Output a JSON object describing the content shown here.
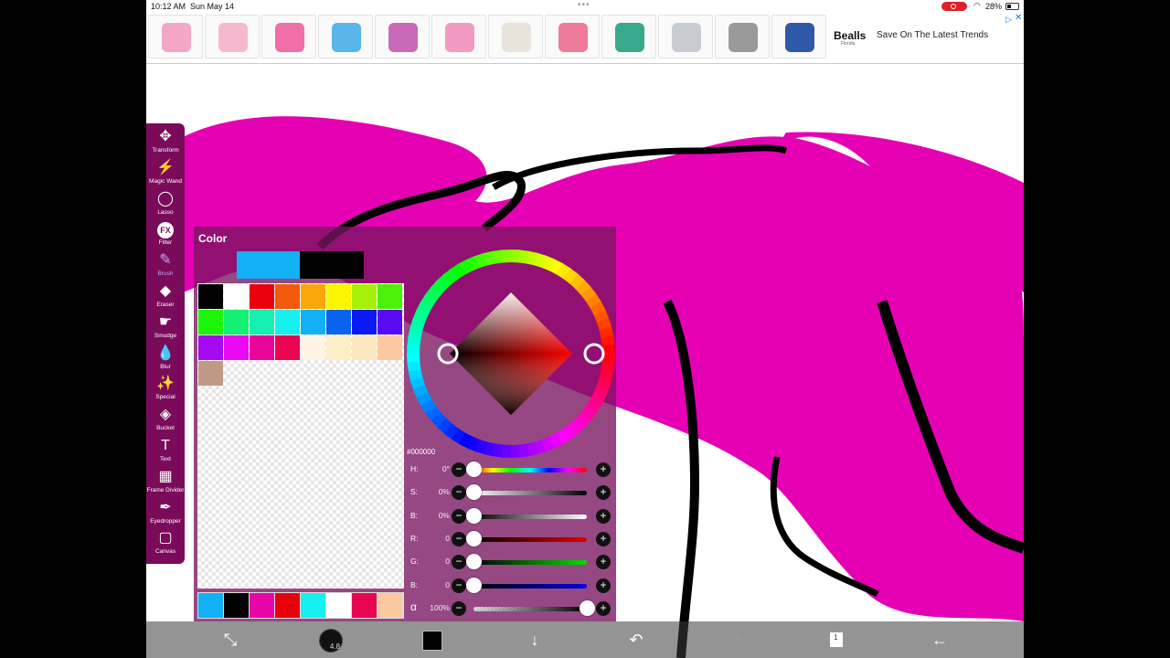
{
  "status_bar": {
    "time": "10:12 AM",
    "date": "Sun May 14",
    "battery": "28%"
  },
  "ad": {
    "products": [
      {
        "icon": "luggage-icon",
        "color": "#f4a6c8"
      },
      {
        "icon": "vanity-set-icon",
        "color": "#f6b8cf"
      },
      {
        "icon": "doll-icon",
        "color": "#f06fa7"
      },
      {
        "icon": "kids-laptop-icon",
        "color": "#59b6e8"
      },
      {
        "icon": "dollhouse-icon",
        "color": "#c96ab8"
      },
      {
        "icon": "playset-icon",
        "color": "#f29ac1"
      },
      {
        "icon": "skull-vase-icon",
        "color": "#e8e4dc"
      },
      {
        "icon": "flamingo-icon",
        "color": "#f07a9a"
      },
      {
        "icon": "turtle-icon",
        "color": "#3aa88c"
      },
      {
        "icon": "rings-icon",
        "color": "#c8ccd2"
      },
      {
        "icon": "cot-icon",
        "color": "#9a9a9a"
      },
      {
        "icon": "flag-icon",
        "color": "#3058a8"
      }
    ],
    "brand": "Bealls",
    "brand_sub": "Florida",
    "tagline": "Save On The Latest Trends"
  },
  "tools": [
    {
      "label": "Transform",
      "icon": "move-icon",
      "glyph": "✥"
    },
    {
      "label": "Magic Wand",
      "icon": "magic-wand-icon",
      "glyph": "⚡"
    },
    {
      "label": "Lasso",
      "icon": "lasso-icon",
      "glyph": "◯"
    },
    {
      "label": "Filter",
      "icon": "fx-icon",
      "glyph": "FX"
    },
    {
      "label": "Brush",
      "icon": "brush-icon",
      "glyph": "✎"
    },
    {
      "label": "Eraser",
      "icon": "eraser-icon",
      "glyph": "◆"
    },
    {
      "label": "Smudge",
      "icon": "smudge-icon",
      "glyph": "☛"
    },
    {
      "label": "Blur",
      "icon": "blur-drop-icon",
      "glyph": "💧"
    },
    {
      "label": "Special",
      "icon": "special-icon",
      "glyph": "✨"
    },
    {
      "label": "Bucket",
      "icon": "bucket-icon",
      "glyph": "◈"
    },
    {
      "label": "Text",
      "icon": "text-icon",
      "glyph": "T"
    },
    {
      "label": "Frame Divider",
      "icon": "frame-divider-icon",
      "glyph": "▦"
    },
    {
      "label": "Eyedropper",
      "icon": "eyedropper-icon",
      "glyph": "✒"
    },
    {
      "label": "Canvas",
      "icon": "canvas-icon",
      "glyph": "▢"
    }
  ],
  "active_tool": "Brush",
  "color_panel": {
    "title": "Color",
    "current_colors": [
      "#12b0f5",
      "#000000"
    ],
    "palette": [
      "#000000",
      "#ffffff",
      "#e8000b",
      "#f05a0a",
      "#f9a70a",
      "#fcf400",
      "#a6f00a",
      "#4cf00a",
      "#1cf50a",
      "#13f072",
      "#17f0b3",
      "#17f0f0",
      "#12b0f5",
      "#0a63f0",
      "#0a1af0",
      "#5a0af0",
      "#a60af0",
      "#ea0af0",
      "#e8059a",
      "#e80552",
      "#fdf4e4",
      "#fdf0c8",
      "#fce8c0",
      "#fcc8a0",
      "#c09a86"
    ],
    "recent": [
      "#12b0f5",
      "#000000",
      "#e805a8",
      "#e8000b",
      "#17f0f0",
      "#ffffff",
      "#e80552",
      "#fcc8a0"
    ],
    "hex": "#000000",
    "sliders": [
      {
        "name": "H:",
        "value": "0°",
        "position": 0,
        "track": "linear-gradient(90deg,#f00,#ff0,#0f0,#0ff,#00f,#f0f,#f00)"
      },
      {
        "name": "S:",
        "value": "0%",
        "position": 0,
        "track": "linear-gradient(90deg,#fff,#000)"
      },
      {
        "name": "B:",
        "value": "0%",
        "position": 0,
        "track": "linear-gradient(90deg,#000,#fff)"
      },
      {
        "name": "R:",
        "value": "0",
        "position": 0,
        "track": "linear-gradient(90deg,#000,#e00000)"
      },
      {
        "name": "G:",
        "value": "0",
        "position": 0,
        "track": "linear-gradient(90deg,#000,#00e000)"
      },
      {
        "name": "B:",
        "value": "0",
        "position": 0,
        "track": "linear-gradient(90deg,#000,#0000e0)"
      },
      {
        "name": "α",
        "value": "100%",
        "position": 1,
        "track": "linear-gradient(90deg,rgba(0,0,0,0),#000)"
      }
    ]
  },
  "bottom_bar": {
    "brush_size": "4.8",
    "layers_count": "1"
  },
  "colors": {
    "accent": "#7a0a5a",
    "artwork_magenta": "#e600b4"
  }
}
